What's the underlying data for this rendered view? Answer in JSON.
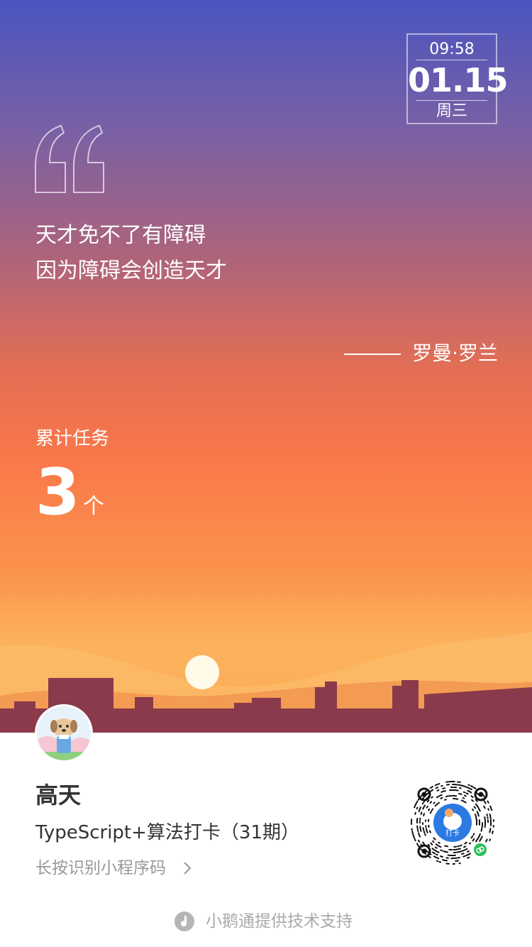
{
  "date_box": {
    "time": "09:58",
    "date": "01.15",
    "weekday": "周三"
  },
  "quote": {
    "lines": [
      "天才免不了有障碍",
      "因为障碍会创造天才"
    ],
    "author": "罗曼·罗兰"
  },
  "tasks": {
    "label": "累计任务",
    "count": "3",
    "unit": "个"
  },
  "user": {
    "name": "高天"
  },
  "course": {
    "title": "TypeScript+算法打卡（31期）"
  },
  "qr_hint": {
    "label": "长按识别小程序码"
  },
  "qr_badge": "打卡",
  "footer": {
    "text": "小鹅通提供技术支持"
  },
  "colors": {
    "sky_top": "#4a55c0",
    "sky_bottom": "#fcb35c",
    "ground": "#8a3a4a",
    "text_dark": "#333333",
    "text_muted": "#999999"
  }
}
